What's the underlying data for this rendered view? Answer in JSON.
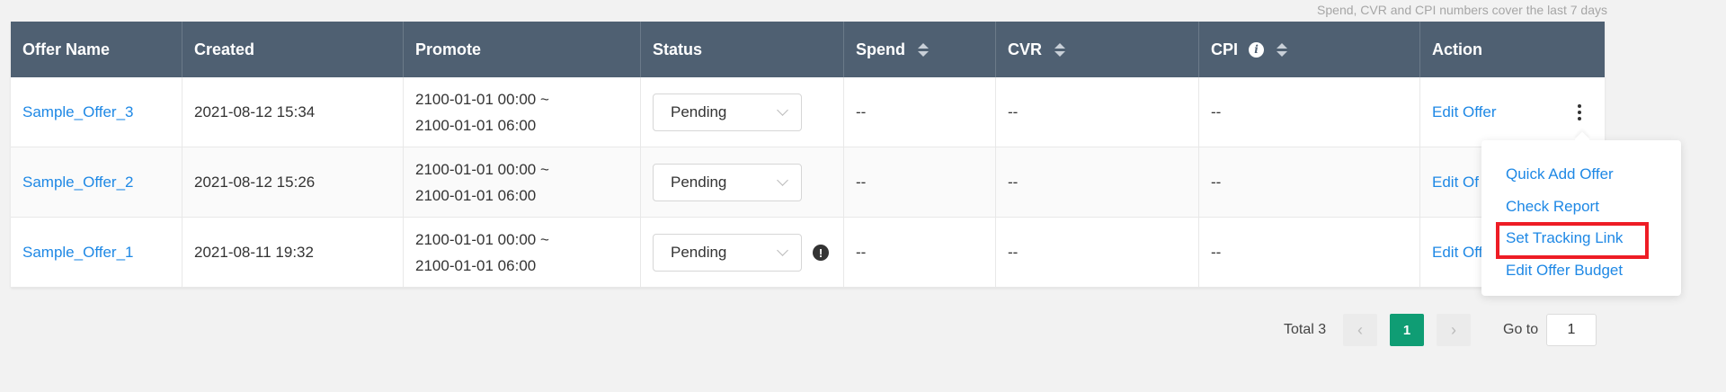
{
  "note": "Spend, CVR and CPI numbers cover the last 7 days",
  "table": {
    "columns": {
      "offer_name": "Offer Name",
      "created": "Created",
      "promote": "Promote",
      "status": "Status",
      "spend": "Spend",
      "cvr": "CVR",
      "cpi": "CPI",
      "action": "Action"
    },
    "rows": [
      {
        "offer_name": "Sample_Offer_3",
        "created": "2021-08-12 15:34",
        "promote_start": "2100-01-01 00:00 ~",
        "promote_end": "2100-01-01 06:00",
        "status": "Pending",
        "spend": "--",
        "cvr": "--",
        "cpi": "--",
        "action": "Edit Offer"
      },
      {
        "offer_name": "Sample_Offer_2",
        "created": "2021-08-12 15:26",
        "promote_start": "2100-01-01 00:00 ~",
        "promote_end": "2100-01-01 06:00",
        "status": "Pending",
        "spend": "--",
        "cvr": "--",
        "cpi": "--",
        "action": "Edit Of"
      },
      {
        "offer_name": "Sample_Offer_1",
        "created": "2021-08-11 19:32",
        "promote_start": "2100-01-01 00:00 ~",
        "promote_end": "2100-01-01 06:00",
        "status": "Pending",
        "spend": "--",
        "cvr": "--",
        "cpi": "--",
        "action": "Edit Offer"
      }
    ]
  },
  "menu": {
    "items": [
      "Quick Add Offer",
      "Check Report",
      "Set Tracking Link",
      "Edit Offer Budget"
    ],
    "highlighted_index": 2,
    "highlight_color": "#ee1c25"
  },
  "pager": {
    "total": "Total 3",
    "prev": "‹",
    "current": "1",
    "next": "›",
    "goto_label": "Go to",
    "goto_value": "1"
  },
  "colors": {
    "header_bg": "#4f6072",
    "link": "#1e88e5",
    "pager_active": "#0f9d74"
  },
  "icons": {
    "sort": "sort-icon",
    "cpi_info": "info-icon",
    "status_warning": "exclamation-icon",
    "row_more": "more-vertical-icon"
  }
}
